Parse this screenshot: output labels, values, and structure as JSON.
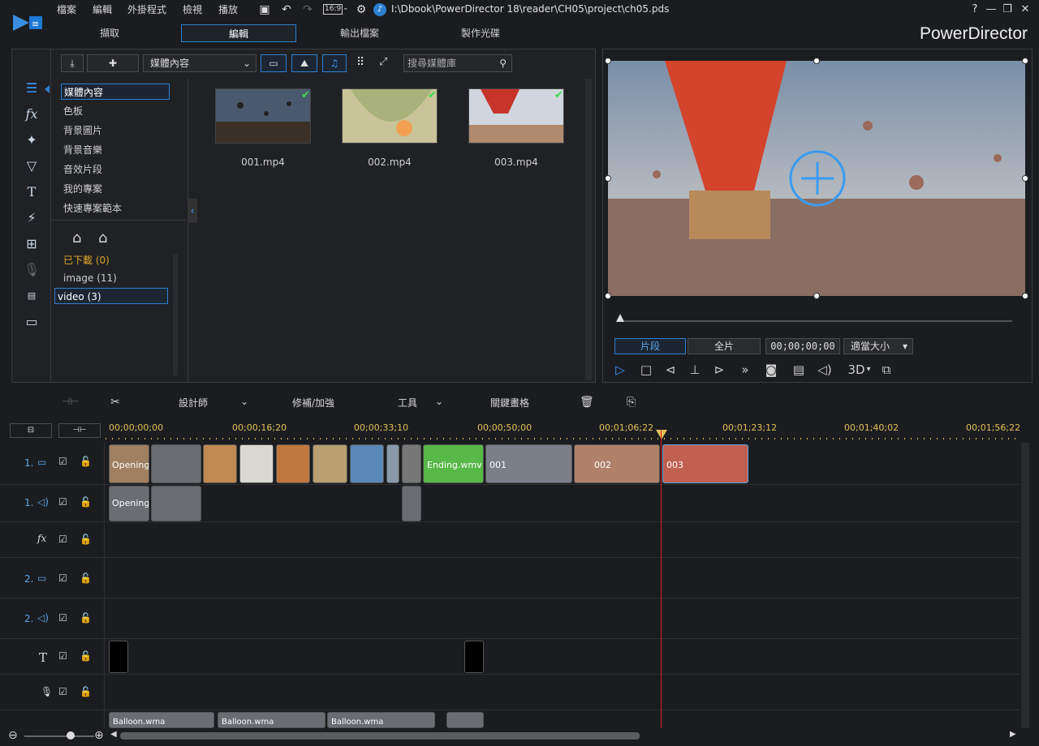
{
  "menu": [
    "檔案",
    "編輯",
    "外掛程式",
    "檢視",
    "播放"
  ],
  "project_path": "I:\\Dbook\\PowerDirector 18\\reader\\CH05\\project\\ch05.pds",
  "aspect_ratio": "16:9",
  "window_controls": {
    "help": "?"
  },
  "brand": "PowerDirector",
  "main_tabs": [
    {
      "label": "擷取",
      "active": false
    },
    {
      "label": "編輯",
      "active": true
    },
    {
      "label": "輸出檔案",
      "active": false
    },
    {
      "label": "製作光碟",
      "active": false
    }
  ],
  "library": {
    "content_dropdown": "媒體內容",
    "search_placeholder": "搜尋媒體庫",
    "categories": [
      "媒體內容",
      "色板",
      "背景圖片",
      "背景音樂",
      "音效片段",
      "我的專案",
      "快速專案範本"
    ],
    "tags": [
      {
        "label": "已下載 (0)"
      },
      {
        "label": "image (11)"
      },
      {
        "label": "video (3)"
      }
    ],
    "media": [
      {
        "name": "001.mp4"
      },
      {
        "name": "002.mp4"
      },
      {
        "name": "003.mp4"
      }
    ]
  },
  "preview": {
    "mode_clip": "片段",
    "mode_full": "全片",
    "timecode": "00;00;00;00",
    "fit_label": "適當大小",
    "three_d": "3D"
  },
  "timeline_toolbar": {
    "designer": "設計師",
    "fix_enhance": "修補/加強",
    "tools": "工具",
    "keyframe": "關鍵畫格"
  },
  "ruler": [
    "00;00;00;00",
    "00;00;16;20",
    "00;00;33;10",
    "00;00;50;00",
    "00;01;06;22",
    "00;01;23;12",
    "00;01;40;02",
    "00;01;56;22"
  ],
  "tracks": [
    {
      "num": "1.",
      "kind": "video"
    },
    {
      "num": "1.",
      "kind": "audio"
    },
    {
      "num": "",
      "kind": "fx"
    },
    {
      "num": "2.",
      "kind": "video"
    },
    {
      "num": "2.",
      "kind": "audio"
    },
    {
      "num": "",
      "kind": "title"
    },
    {
      "num": "",
      "kind": "voice"
    },
    {
      "num": "",
      "kind": "music"
    }
  ],
  "clips": {
    "opening": "Opening",
    "ending": "Ending.wmv",
    "c001": "001",
    "c002": "002",
    "c003": "003",
    "balloon": "Balloon.wma"
  },
  "colors": {
    "accent": "#2d7fd1",
    "playhead": "#dd2222",
    "timecode": "#e4c15b"
  }
}
